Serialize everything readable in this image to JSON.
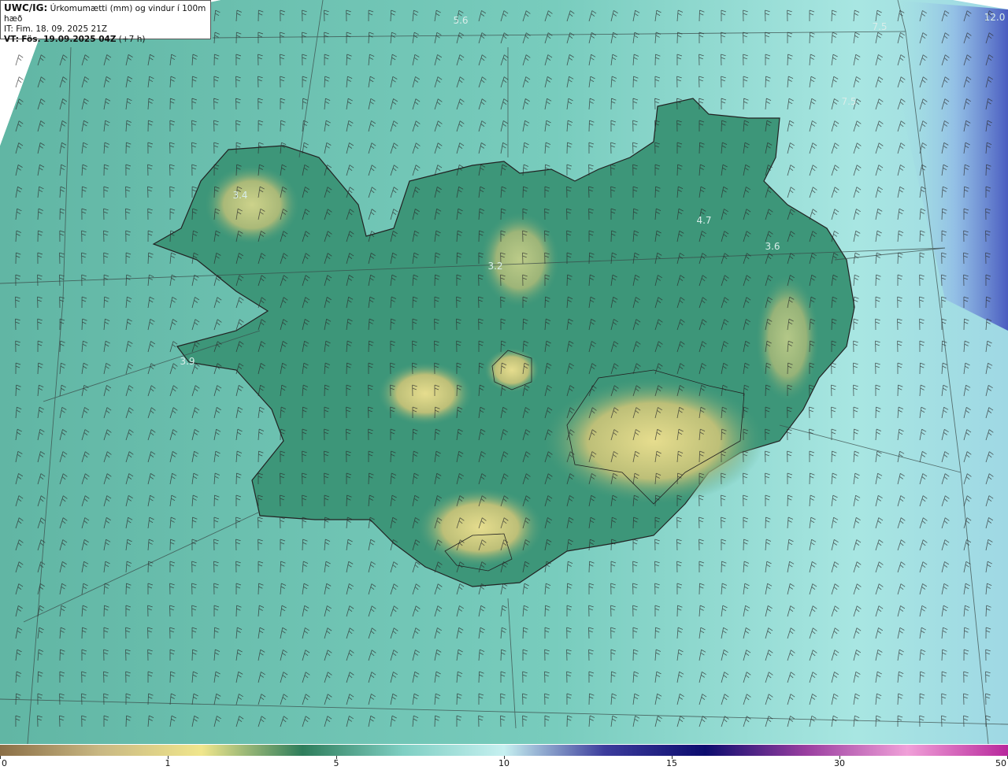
{
  "header": {
    "model": "UWC/IG:",
    "title": "Úrkomumætti (mm) og vindur í 100m hæð",
    "init_label": "IT:",
    "init_time": "Fim. 18. 09. 2025 21Z",
    "valid_label": "VT:",
    "valid_time": "Fös. 19.09.2025 04Z",
    "lead": "(+7 h)"
  },
  "map_labels": [
    {
      "text": "5.6"
    },
    {
      "text": "7.5"
    },
    {
      "text": "12.0"
    },
    {
      "text": "7.5"
    },
    {
      "text": "3.4"
    },
    {
      "text": "4.7"
    },
    {
      "text": "3.6"
    },
    {
      "text": "3.2"
    },
    {
      "text": "3.9"
    }
  ],
  "colorbar": {
    "ticks": [
      {
        "label": "0"
      },
      {
        "label": "1"
      },
      {
        "label": "5"
      },
      {
        "label": "10"
      },
      {
        "label": "15"
      },
      {
        "label": "30"
      },
      {
        "label": "50"
      }
    ],
    "colors": [
      "#8b6f47",
      "#c9b883",
      "#f0e68c",
      "#2e7d5b",
      "#7fcfc3",
      "#c6f0f0",
      "#3c3c9c",
      "#0c0c6e",
      "#9a3fa0",
      "#f0a0d8",
      "#b8289c"
    ]
  },
  "colors": {
    "sea": "#6ec5b6",
    "land_low": "#3f9a7c",
    "land_high": "#d8cf7c",
    "coast": "#222222",
    "barb": "#2a2a2a",
    "deep": "#5a6fc0"
  }
}
